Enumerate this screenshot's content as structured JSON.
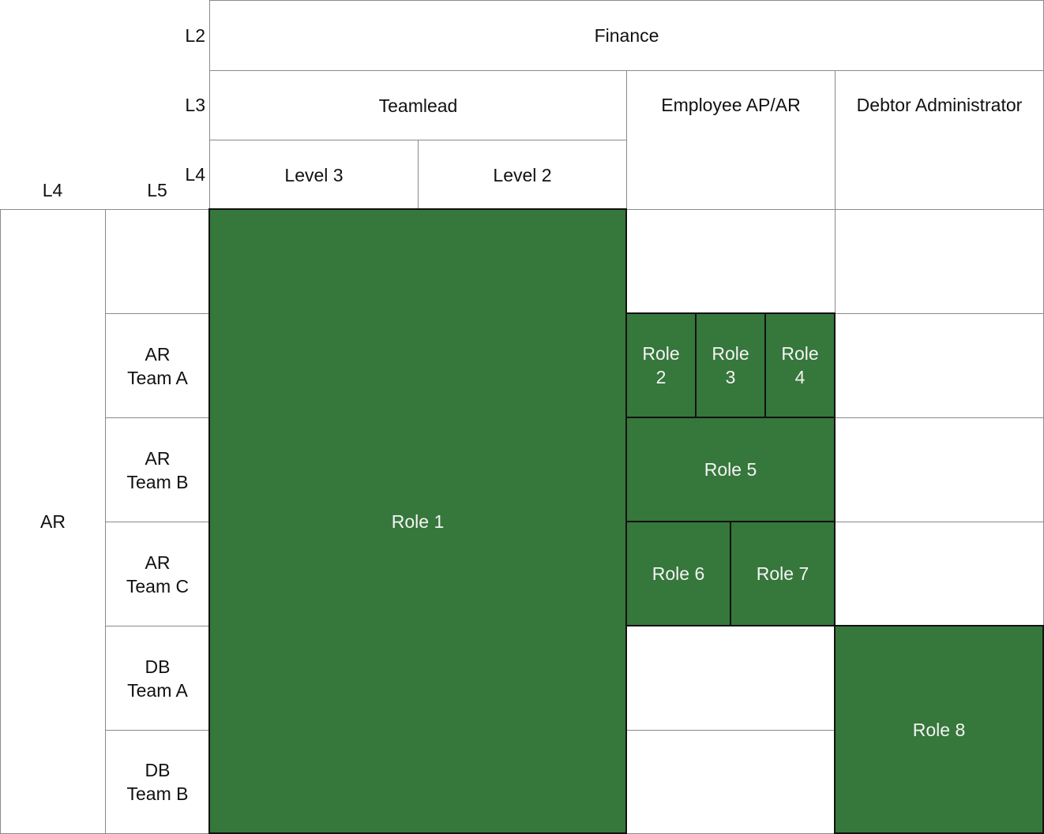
{
  "level_labels": {
    "l2": "L2",
    "l3": "L3",
    "l4_top": "L4",
    "l4_side": "L4",
    "l5_side": "L5"
  },
  "columns": {
    "l2": "Finance",
    "l3": [
      "Teamlead",
      "Employee AP/AR",
      "Debtor Administrator"
    ],
    "l4": [
      "Level 3",
      "Level 2"
    ]
  },
  "rows": {
    "l4": "AR",
    "l5": [
      "AR\nTeam A",
      "AR\nTeam B",
      "AR\nTeam C",
      "DB\nTeam A",
      "DB\nTeam B"
    ]
  },
  "roles": [
    {
      "label": "Role 1"
    },
    {
      "label": "Role\n2"
    },
    {
      "label": "Role\n3"
    },
    {
      "label": "Role\n4"
    },
    {
      "label": "Role 5"
    },
    {
      "label": "Role 6"
    },
    {
      "label": "Role 7"
    },
    {
      "label": "Role 8"
    }
  ],
  "colors": {
    "role_fill": "#36773b",
    "border": "#8a8a8a"
  }
}
